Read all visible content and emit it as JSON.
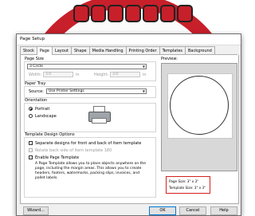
{
  "dialog": {
    "title": "Page Setup",
    "tabs": [
      {
        "label": "Stock",
        "active": false
      },
      {
        "label": "Page",
        "active": true
      },
      {
        "label": "Layout",
        "active": false
      },
      {
        "label": "Shape",
        "active": false
      },
      {
        "label": "Media Handling",
        "active": false
      },
      {
        "label": "Printing Order",
        "active": false
      },
      {
        "label": "Templates",
        "active": false
      },
      {
        "label": "Background",
        "active": false
      }
    ]
  },
  "page_size": {
    "group_label": "Page Size",
    "selected": "3 Circle",
    "width_label": "Width:",
    "width_value": "3.0",
    "width_unit": "in",
    "height_label": "Height:",
    "height_value": "3.0",
    "height_unit": "in"
  },
  "paper_tray": {
    "group_label": "Paper Tray",
    "source_label": "Source:",
    "source_value": "Use Printer Settings"
  },
  "orientation": {
    "group_label": "Orientation",
    "portrait_label": "Portrait",
    "landscape_label": "Landscape",
    "selected": "Portrait"
  },
  "template_design": {
    "group_label": "Template Design Options",
    "separate_label": "Separate designs for front and back of item template",
    "rotate_label": "Rotate back side of item template 180",
    "enable_label": "Enable Page Template",
    "description": "A Page Template allows you to place objects anywhere on the page, including the margin areas. This allows you to create headers, footers, watermarks, packing slips, invoices, and pallet labels."
  },
  "preview": {
    "label": "Preview:",
    "page_size_text": "Page Size: 3\" x 3\"",
    "template_size_text": "Template Size: 3\" x 3\""
  },
  "buttons": {
    "wizard": "Wizard...",
    "ok": "OK",
    "cancel": "Cancel",
    "help": "Help"
  },
  "colors": {
    "background_ring": "#c7202a",
    "highlight_box": "#d42020",
    "primary_button_border": "#0078d7"
  }
}
